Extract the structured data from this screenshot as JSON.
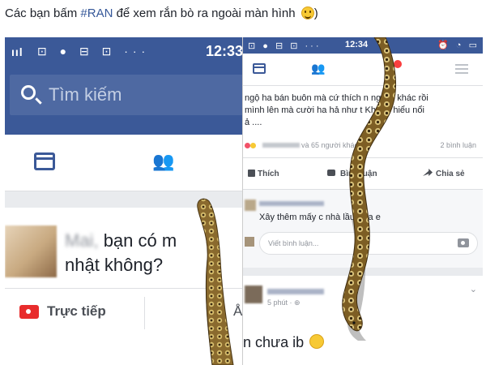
{
  "caption": {
    "before": "Các bạn bấm ",
    "hashtag": "#RAN",
    "after": " để xem rắn bò ra ngoài màn hình ",
    "tail": ")"
  },
  "left_screen": {
    "status": {
      "signal": "ııl",
      "icons": "⊡ ● ⊟ ⊡ ···",
      "time": "12:33"
    },
    "search_placeholder": "Tìm kiếm",
    "status_prompt_name": "Mai,",
    "status_prompt": "bạn có muốn cập nhật không?",
    "status_prompt_line1": "bạn có m",
    "status_prompt_line2": "nhật không?",
    "live_label": "Trực tiếp",
    "cut_letter": "Å"
  },
  "right_screen": {
    "status": {
      "icons": "⊡ ● ⊟ ⊡ ···",
      "time": "12:34",
      "right_icons": "⏰ ◔ ▭"
    },
    "post_text": "ngộ ha bán buôn mà cứ thích ... người khác rồi mình lên mà cười ha hả như t... Không hiểu nổi ả ....",
    "post_line1": "ngộ ha bán buôn mà cứ thích  n người khác rồi",
    "post_line2": "mình lên mà cười ha hả như t    Không hiểu nổi",
    "post_line3": "ả ....",
    "reactions_text": "và 65 người khác",
    "comments_count": "2 bình luận",
    "actions": {
      "like": "Thích",
      "comment": "Bình luận",
      "share": "Chia sẻ"
    },
    "comment_text": "Xây thêm mấy c   nhà lầu nữa e",
    "comment_placeholder": "Viết bình luận...",
    "post2_meta": "5 phút · ⊕",
    "post2_text": "n chưa ib",
    "chevron": "⌄"
  }
}
